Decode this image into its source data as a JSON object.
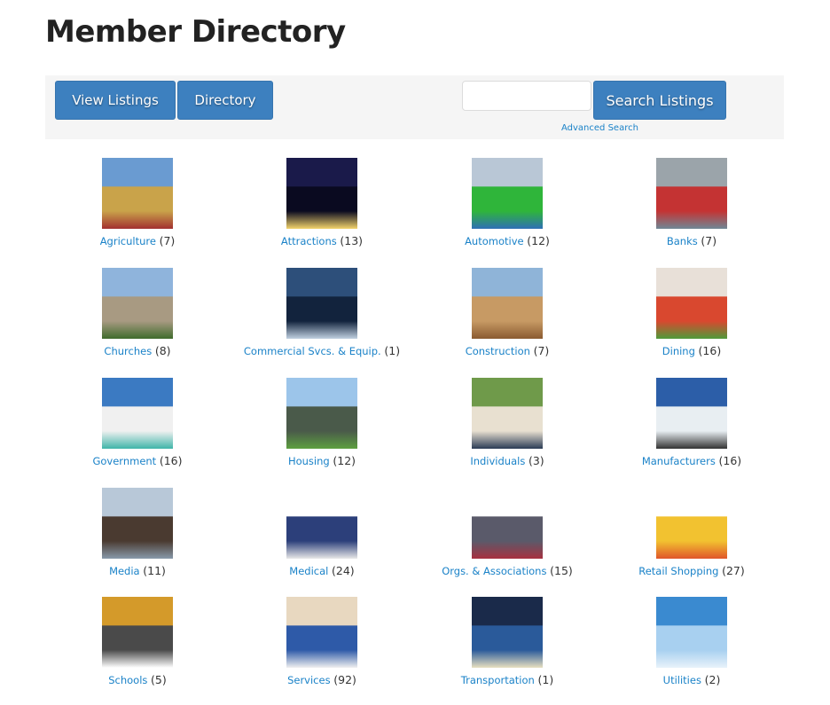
{
  "page": {
    "title": "Member Directory"
  },
  "toolbar": {
    "view_listings_label": "View Listings",
    "directory_label": "Directory",
    "search": {
      "value": "",
      "placeholder": ""
    },
    "search_button_label": "Search Listings",
    "advanced_search_label": "Advanced Search"
  },
  "colors": {
    "button": "#3d80bf",
    "link": "#1a82c8",
    "toolbar_bg": "#f5f5f5"
  },
  "categories": [
    {
      "name": "Agriculture",
      "count": "(7)",
      "image": "combine-harvester-wheat-field"
    },
    {
      "name": "Attractions",
      "count": "(13)",
      "image": "route-66-sign-night"
    },
    {
      "name": "Automotive",
      "count": "(12)",
      "image": "people-with-green-car"
    },
    {
      "name": "Banks",
      "count": "(7)",
      "image": "atm-machine"
    },
    {
      "name": "Churches",
      "count": "(8)",
      "image": "stone-church"
    },
    {
      "name": "Commercial Svcs. & Equip.",
      "count": "(1)",
      "image": "welder-in-workshop"
    },
    {
      "name": "Construction",
      "count": "(7)",
      "image": "wooden-house-frame"
    },
    {
      "name": "Dining",
      "count": "(16)",
      "image": "salad-bowl"
    },
    {
      "name": "Government",
      "count": "(16)",
      "image": "columned-government-building"
    },
    {
      "name": "Housing",
      "count": "(12)",
      "image": "suburban-house"
    },
    {
      "name": "Individuals",
      "count": "(3)",
      "image": "family-in-park"
    },
    {
      "name": "Manufacturers",
      "count": "(16)",
      "image": "factory-smokestacks"
    },
    {
      "name": "Media",
      "count": "(11)",
      "image": "tv-studio-anchor"
    },
    {
      "name": "Medical",
      "count": "(24)",
      "image": "medical-staff-group"
    },
    {
      "name": "Orgs. & Associations",
      "count": "(15)",
      "image": "group-of-people"
    },
    {
      "name": "Retail Shopping",
      "count": "(27)",
      "image": "shopping-bags"
    },
    {
      "name": "Schools",
      "count": "(5)",
      "image": "school-bus-children"
    },
    {
      "name": "Services",
      "count": "(92)",
      "image": "office-team"
    },
    {
      "name": "Transportation",
      "count": "(1)",
      "image": "taxi-cab"
    },
    {
      "name": "Utilities",
      "count": "(2)",
      "image": "power-lines"
    }
  ]
}
